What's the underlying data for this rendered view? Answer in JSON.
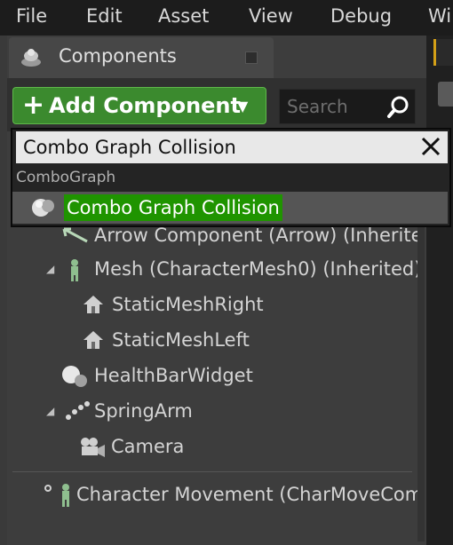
{
  "menu": {
    "items": [
      "File",
      "Edit",
      "Asset",
      "View",
      "Debug",
      "Wi"
    ]
  },
  "panel": {
    "tab_label": "Components",
    "add_button_label": "Add Component",
    "search_placeholder": "Search"
  },
  "dropdown": {
    "search_value": "Combo Graph Collision",
    "category": "ComboGraph",
    "item_label": "Combo Graph Collision"
  },
  "tree": {
    "items": [
      "Arrow Component (Arrow) (Inherited)",
      "Mesh (CharacterMesh0) (Inherited)",
      "StaticMeshRight",
      "StaticMeshLeft",
      "HealthBarWidget",
      "SpringArm",
      "Camera",
      "Character Movement (CharMoveComp) (Inherited)"
    ]
  },
  "colors": {
    "add_button": "#3b8a2e",
    "highlight": "#1f9400",
    "accent": "#d4a017"
  }
}
